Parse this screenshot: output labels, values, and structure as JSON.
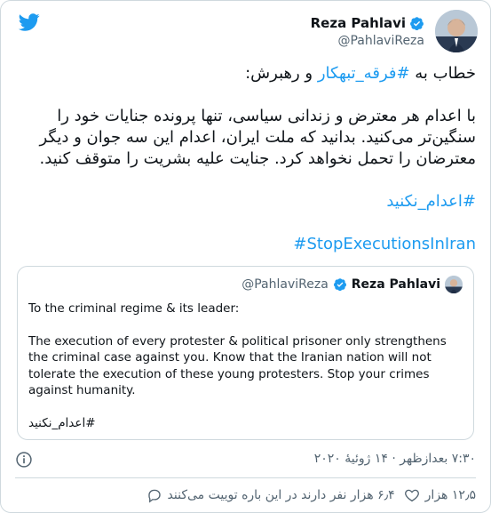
{
  "author": {
    "name": "Reza Pahlavi",
    "handle": "@PahlaviReza"
  },
  "tweet": {
    "line1_prefix": "خطاب به ",
    "line1_hashtag": "#فرقه_تبهکار",
    "line1_suffix": " و رهبرش:",
    "paragraph": "با اعدام هر معترض و زندانی سیاسی، تنها پرونده جنایات خود را سنگین‌تر می‌کنید. بدانید که ملت ایران، اعدام این سه جوان و دیگر معترضان را تحمل نخواهد کرد. جنایت علیه بشریت را متوقف کنید.",
    "hashtag_fa": "#اعدام_نکنید",
    "hashtag_en": "#StopExecutionsInIran"
  },
  "quote": {
    "name": "Reza Pahlavi",
    "handle": "@PahlaviReza",
    "line1": "To the criminal regime & its leader:",
    "paragraph": "The execution of every protester & political prisoner only strengthens the criminal case against you. Know that the Iranian nation will not tolerate the execution of these young protesters. Stop your crimes against humanity.",
    "hashtag": "#اعدام_نکنید"
  },
  "meta": {
    "timestamp": "۷:۳۰ بعدازظهر · ۱۴ ژوئیهٔ ۲۰۲۰"
  },
  "actions": {
    "likes": "۱۲٫۵ هزار",
    "talking": "۶٫۴ هزار نفر دارند در این باره توییت می‌کنند"
  },
  "colors": {
    "accent": "#1d9bf0",
    "muted": "#536471",
    "border": "#cfd9de"
  }
}
